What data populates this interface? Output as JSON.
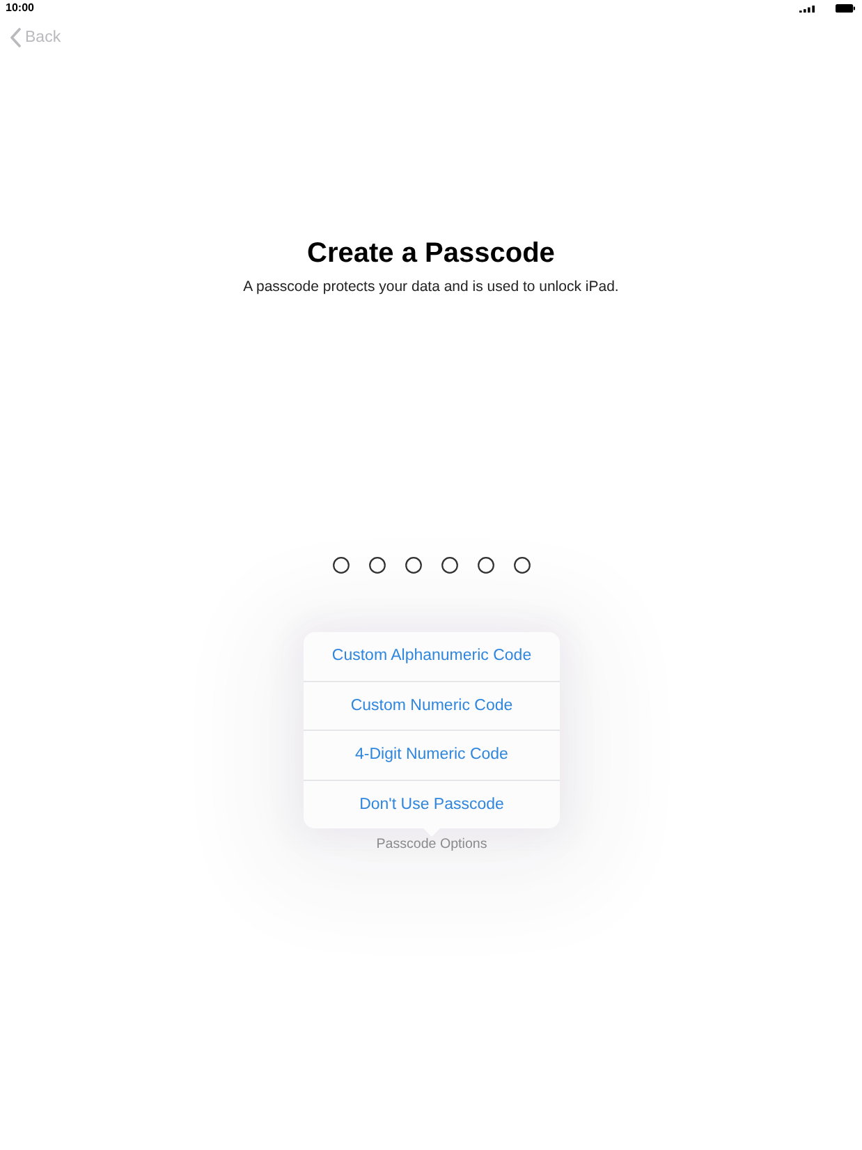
{
  "status_bar": {
    "time": "10:00"
  },
  "nav": {
    "back": {
      "label": "Back",
      "disabled": true
    }
  },
  "header": {
    "title": "Create a Passcode",
    "subtitle": "A passcode protects your data and is used to unlock iPad."
  },
  "passcode_dots": [
    {
      "filled": false
    },
    {
      "filled": false
    },
    {
      "filled": false
    },
    {
      "filled": false
    },
    {
      "filled": false
    },
    {
      "filled": false
    }
  ],
  "options_popover": {
    "items": [
      {
        "label": "Custom Alphanumeric Code"
      },
      {
        "label": "Custom Numeric Code"
      },
      {
        "label": "4-Digit Numeric Code"
      },
      {
        "label": "Don't Use Passcode"
      }
    ],
    "button": {
      "label": "Passcode Options"
    }
  }
}
